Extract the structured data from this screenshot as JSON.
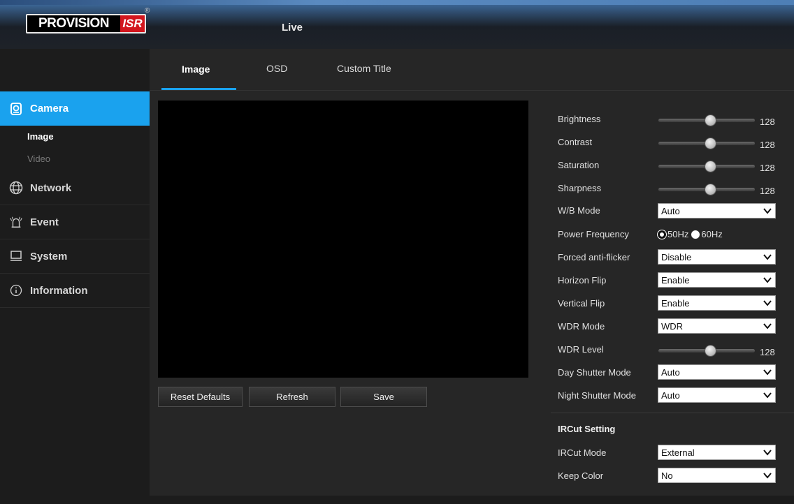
{
  "header": {
    "logo_text": "PROVISION",
    "logo_isr": "ISR",
    "logo_reg": "®",
    "nav_live": "Live"
  },
  "sidebar": {
    "categories": [
      {
        "label": "Camera",
        "icon": "camera-icon",
        "active": true
      },
      {
        "label": "Network",
        "icon": "network-globe-icon",
        "active": false
      },
      {
        "label": "Event",
        "icon": "alarm-icon",
        "active": false
      },
      {
        "label": "System",
        "icon": "monitor-icon",
        "active": false
      },
      {
        "label": "Information",
        "icon": "info-icon",
        "active": false
      }
    ],
    "sub_items": [
      {
        "label": "Image",
        "active": true
      },
      {
        "label": "Video",
        "active": false
      }
    ]
  },
  "tabs": [
    {
      "label": "Image",
      "active": true
    },
    {
      "label": "OSD",
      "active": false
    },
    {
      "label": "Custom Title",
      "active": false
    }
  ],
  "buttons": {
    "reset": "Reset Defaults",
    "refresh": "Refresh",
    "save": "Save"
  },
  "settings": {
    "brightness": {
      "label": "Brightness",
      "value": "128",
      "fraction": 0.5
    },
    "contrast": {
      "label": "Contrast",
      "value": "128",
      "fraction": 0.5
    },
    "saturation": {
      "label": "Saturation",
      "value": "128",
      "fraction": 0.5
    },
    "sharpness": {
      "label": "Sharpness",
      "value": "128",
      "fraction": 0.5
    },
    "wb_mode": {
      "label": "W/B Mode",
      "value": "Auto"
    },
    "power_frequency": {
      "label": "Power Frequency",
      "options": [
        "50Hz",
        "60Hz"
      ],
      "selected": "50Hz"
    },
    "forced_antiflicker": {
      "label": "Forced anti-flicker",
      "value": "Disable"
    },
    "horizon_flip": {
      "label": "Horizon Flip",
      "value": "Enable"
    },
    "vertical_flip": {
      "label": "Vertical Flip",
      "value": "Enable"
    },
    "wdr_mode": {
      "label": "WDR Mode",
      "value": "WDR"
    },
    "wdr_level": {
      "label": "WDR Level",
      "value": "128",
      "fraction": 0.5
    },
    "day_shutter": {
      "label": "Day Shutter Mode",
      "value": "Auto"
    },
    "night_shutter": {
      "label": "Night Shutter Mode",
      "value": "Auto"
    }
  },
  "ircut": {
    "title": "IRCut Setting",
    "mode": {
      "label": "IRCut Mode",
      "value": "External"
    },
    "keep_color": {
      "label": "Keep Color",
      "value": "No"
    }
  },
  "colors": {
    "accent": "#1aa2ee",
    "logo_red": "#d3161e"
  }
}
